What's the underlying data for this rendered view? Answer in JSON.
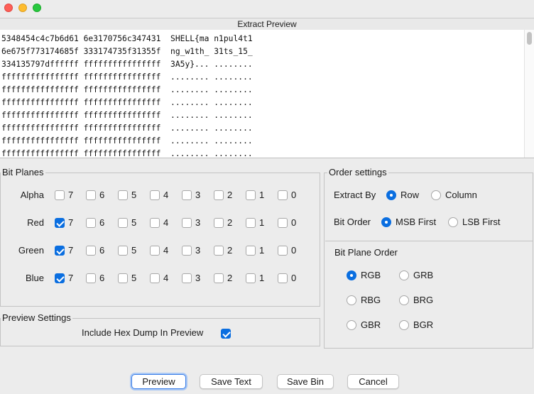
{
  "window": {
    "title": "Extract Preview"
  },
  "preview": {
    "lines": [
      "5348454c4c7b6d61 6e3170756c347431  SHELL{ma n1pul4t1",
      "6e675f773174685f 333174735f31355f  ng_w1th_ 31ts_15_",
      "334135797dffffff ffffffffffffffff  3A5y}... ........",
      "ffffffffffffffff ffffffffffffffff  ........ ........",
      "ffffffffffffffff ffffffffffffffff  ........ ........",
      "ffffffffffffffff ffffffffffffffff  ........ ........",
      "ffffffffffffffff ffffffffffffffff  ........ ........",
      "ffffffffffffffff ffffffffffffffff  ........ ........",
      "ffffffffffffffff ffffffffffffffff  ........ ........",
      "ffffffffffffffff ffffffffffffffff  ........ ........"
    ]
  },
  "bit_planes": {
    "title": "Bit Planes",
    "bit_labels": [
      "7",
      "6",
      "5",
      "4",
      "3",
      "2",
      "1",
      "0"
    ],
    "rows": [
      {
        "label": "Alpha",
        "checked": [
          false,
          false,
          false,
          false,
          false,
          false,
          false,
          false
        ]
      },
      {
        "label": "Red",
        "checked": [
          true,
          false,
          false,
          false,
          false,
          false,
          false,
          false
        ]
      },
      {
        "label": "Green",
        "checked": [
          true,
          false,
          false,
          false,
          false,
          false,
          false,
          false
        ]
      },
      {
        "label": "Blue",
        "checked": [
          true,
          false,
          false,
          false,
          false,
          false,
          false,
          false
        ]
      }
    ]
  },
  "preview_settings": {
    "title": "Preview Settings",
    "hex_dump_label": "Include Hex Dump In Preview",
    "hex_dump_checked": true
  },
  "order_settings": {
    "title": "Order settings",
    "extract_by": {
      "label": "Extract By",
      "options": [
        "Row",
        "Column"
      ],
      "selected": "Row"
    },
    "bit_order": {
      "label": "Bit Order",
      "options": [
        "MSB First",
        "LSB First"
      ],
      "selected": "MSB First"
    },
    "bit_plane_order": {
      "label": "Bit Plane Order",
      "options": [
        "RGB",
        "GRB",
        "RBG",
        "BRG",
        "GBR",
        "BGR"
      ],
      "selected": "RGB"
    }
  },
  "buttons": {
    "preview": "Preview",
    "save_text": "Save Text",
    "save_bin": "Save Bin",
    "cancel": "Cancel"
  },
  "colors": {
    "accent": "#0a6ee0",
    "background": "#ececec"
  }
}
